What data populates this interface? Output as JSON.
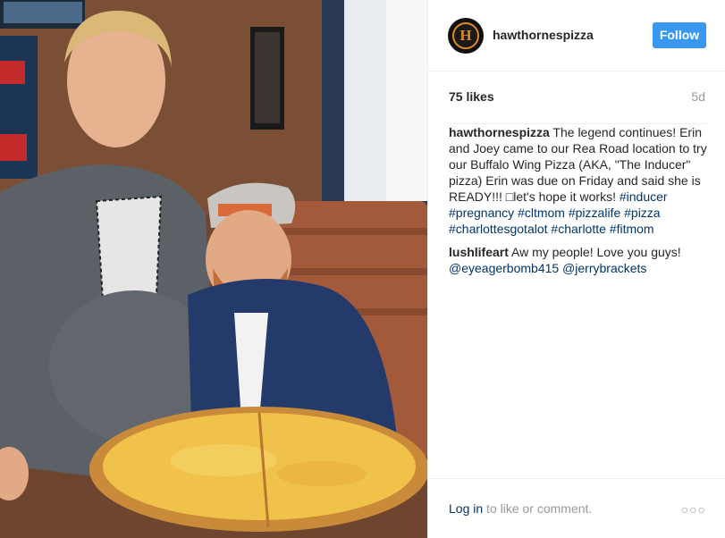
{
  "post": {
    "username": "hawthornespizza",
    "avatar_letter": "H",
    "follow_label": "Follow",
    "likes": "75 likes",
    "age": "5d",
    "caption": {
      "user": "hawthornespizza",
      "text": " The legend continues! Erin and Joey came to our Rea Road location to try our Buffalo Wing Pizza (AKA, \"The Inducer\" pizza) Erin was due on Friday and said she is READY!!! □let's hope it works! ",
      "hashtags": [
        "#inducer",
        "#pregnancy",
        "#cltmom",
        "#pizzalife",
        "#pizza",
        "#charlottesgotalot",
        "#charlotte",
        "#fitmom"
      ]
    },
    "comment": {
      "user": "lushlifeart",
      "text": " Aw my people! Love you guys! ",
      "mentions": [
        "@eyeagerbomb415",
        "@jerrybrackets"
      ]
    },
    "footer": {
      "login_label": "Log in",
      "login_suffix": " to like or comment.",
      "more_icon": "ellipsis-icon"
    }
  },
  "colors": {
    "follow_button": "#3897f0",
    "link": "#003569",
    "muted": "#999999",
    "text": "#262626"
  }
}
